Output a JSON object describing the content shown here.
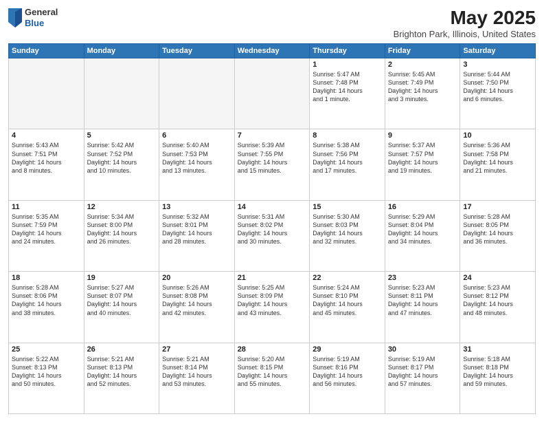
{
  "header": {
    "logo_general": "General",
    "logo_blue": "Blue",
    "main_title": "May 2025",
    "subtitle": "Brighton Park, Illinois, United States"
  },
  "calendar": {
    "days_of_week": [
      "Sunday",
      "Monday",
      "Tuesday",
      "Wednesday",
      "Thursday",
      "Friday",
      "Saturday"
    ],
    "weeks": [
      [
        {
          "day": "",
          "empty": true
        },
        {
          "day": "",
          "empty": true
        },
        {
          "day": "",
          "empty": true
        },
        {
          "day": "",
          "empty": true
        },
        {
          "day": "1",
          "info": "Sunrise: 5:47 AM\nSunset: 7:48 PM\nDaylight: 14 hours\nand 1 minute."
        },
        {
          "day": "2",
          "info": "Sunrise: 5:45 AM\nSunset: 7:49 PM\nDaylight: 14 hours\nand 3 minutes."
        },
        {
          "day": "3",
          "info": "Sunrise: 5:44 AM\nSunset: 7:50 PM\nDaylight: 14 hours\nand 6 minutes."
        }
      ],
      [
        {
          "day": "4",
          "info": "Sunrise: 5:43 AM\nSunset: 7:51 PM\nDaylight: 14 hours\nand 8 minutes."
        },
        {
          "day": "5",
          "info": "Sunrise: 5:42 AM\nSunset: 7:52 PM\nDaylight: 14 hours\nand 10 minutes."
        },
        {
          "day": "6",
          "info": "Sunrise: 5:40 AM\nSunset: 7:53 PM\nDaylight: 14 hours\nand 13 minutes."
        },
        {
          "day": "7",
          "info": "Sunrise: 5:39 AM\nSunset: 7:55 PM\nDaylight: 14 hours\nand 15 minutes."
        },
        {
          "day": "8",
          "info": "Sunrise: 5:38 AM\nSunset: 7:56 PM\nDaylight: 14 hours\nand 17 minutes."
        },
        {
          "day": "9",
          "info": "Sunrise: 5:37 AM\nSunset: 7:57 PM\nDaylight: 14 hours\nand 19 minutes."
        },
        {
          "day": "10",
          "info": "Sunrise: 5:36 AM\nSunset: 7:58 PM\nDaylight: 14 hours\nand 21 minutes."
        }
      ],
      [
        {
          "day": "11",
          "info": "Sunrise: 5:35 AM\nSunset: 7:59 PM\nDaylight: 14 hours\nand 24 minutes."
        },
        {
          "day": "12",
          "info": "Sunrise: 5:34 AM\nSunset: 8:00 PM\nDaylight: 14 hours\nand 26 minutes."
        },
        {
          "day": "13",
          "info": "Sunrise: 5:32 AM\nSunset: 8:01 PM\nDaylight: 14 hours\nand 28 minutes."
        },
        {
          "day": "14",
          "info": "Sunrise: 5:31 AM\nSunset: 8:02 PM\nDaylight: 14 hours\nand 30 minutes."
        },
        {
          "day": "15",
          "info": "Sunrise: 5:30 AM\nSunset: 8:03 PM\nDaylight: 14 hours\nand 32 minutes."
        },
        {
          "day": "16",
          "info": "Sunrise: 5:29 AM\nSunset: 8:04 PM\nDaylight: 14 hours\nand 34 minutes."
        },
        {
          "day": "17",
          "info": "Sunrise: 5:28 AM\nSunset: 8:05 PM\nDaylight: 14 hours\nand 36 minutes."
        }
      ],
      [
        {
          "day": "18",
          "info": "Sunrise: 5:28 AM\nSunset: 8:06 PM\nDaylight: 14 hours\nand 38 minutes."
        },
        {
          "day": "19",
          "info": "Sunrise: 5:27 AM\nSunset: 8:07 PM\nDaylight: 14 hours\nand 40 minutes."
        },
        {
          "day": "20",
          "info": "Sunrise: 5:26 AM\nSunset: 8:08 PM\nDaylight: 14 hours\nand 42 minutes."
        },
        {
          "day": "21",
          "info": "Sunrise: 5:25 AM\nSunset: 8:09 PM\nDaylight: 14 hours\nand 43 minutes."
        },
        {
          "day": "22",
          "info": "Sunrise: 5:24 AM\nSunset: 8:10 PM\nDaylight: 14 hours\nand 45 minutes."
        },
        {
          "day": "23",
          "info": "Sunrise: 5:23 AM\nSunset: 8:11 PM\nDaylight: 14 hours\nand 47 minutes."
        },
        {
          "day": "24",
          "info": "Sunrise: 5:23 AM\nSunset: 8:12 PM\nDaylight: 14 hours\nand 48 minutes."
        }
      ],
      [
        {
          "day": "25",
          "info": "Sunrise: 5:22 AM\nSunset: 8:13 PM\nDaylight: 14 hours\nand 50 minutes."
        },
        {
          "day": "26",
          "info": "Sunrise: 5:21 AM\nSunset: 8:13 PM\nDaylight: 14 hours\nand 52 minutes."
        },
        {
          "day": "27",
          "info": "Sunrise: 5:21 AM\nSunset: 8:14 PM\nDaylight: 14 hours\nand 53 minutes."
        },
        {
          "day": "28",
          "info": "Sunrise: 5:20 AM\nSunset: 8:15 PM\nDaylight: 14 hours\nand 55 minutes."
        },
        {
          "day": "29",
          "info": "Sunrise: 5:19 AM\nSunset: 8:16 PM\nDaylight: 14 hours\nand 56 minutes."
        },
        {
          "day": "30",
          "info": "Sunrise: 5:19 AM\nSunset: 8:17 PM\nDaylight: 14 hours\nand 57 minutes."
        },
        {
          "day": "31",
          "info": "Sunrise: 5:18 AM\nSunset: 8:18 PM\nDaylight: 14 hours\nand 59 minutes."
        }
      ]
    ]
  }
}
